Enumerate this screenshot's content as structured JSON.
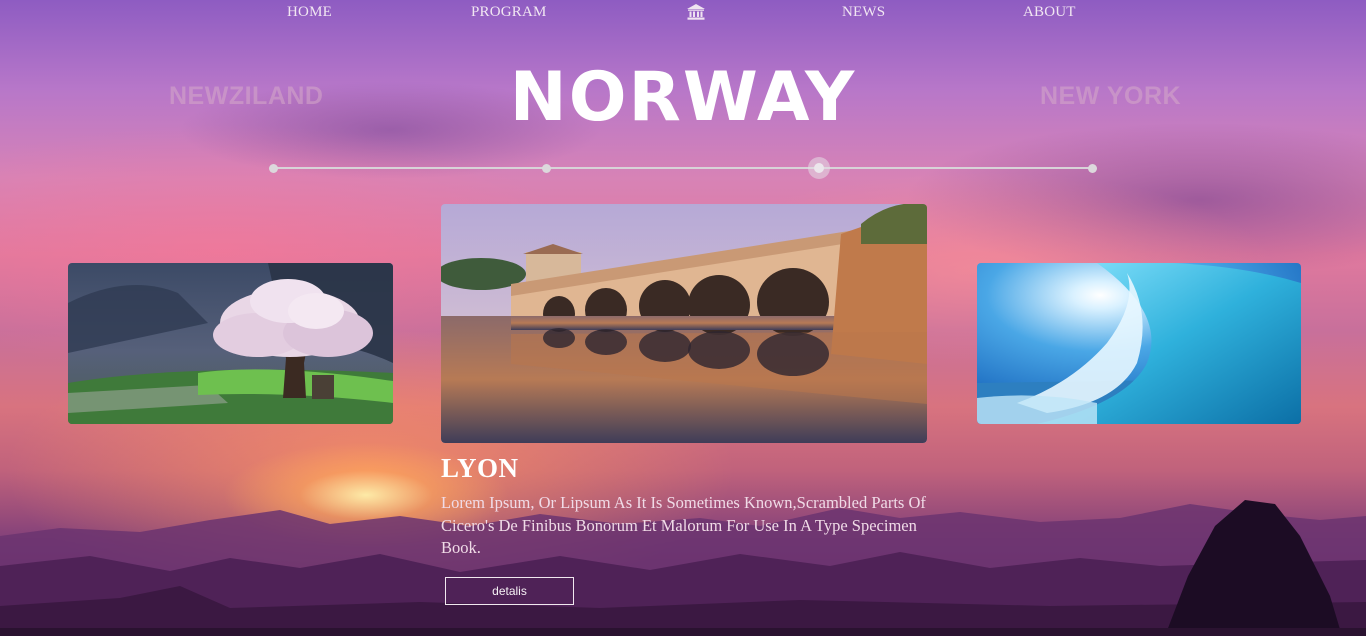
{
  "nav": {
    "home": "HOME",
    "program": "PROGRAM",
    "logo_icon": "bank-building-icon",
    "news": "NEWS",
    "about": "ABOUT"
  },
  "hero": {
    "prev_city": "NEWZILAND",
    "current_city": "NORWAY",
    "next_city": "NEW YORK"
  },
  "slider": {
    "total_stops": 4,
    "active_index": 2
  },
  "cards": {
    "left_image": "cherry-blossom-tree",
    "center_image": "stone-arch-bridge-over-river",
    "right_image": "ocean-wave"
  },
  "featured": {
    "title": "LYON",
    "description": "Lorem Ipsum, Or Lipsum As It Is Sometimes Known,Scrambled Parts Of Cicero's De Finibus Bonorum Et Malorum For Use In A Type Specimen Book.",
    "button_label": "detalis"
  },
  "colors": {
    "title": "#ffffff",
    "text_muted": "#f0dbe7"
  }
}
